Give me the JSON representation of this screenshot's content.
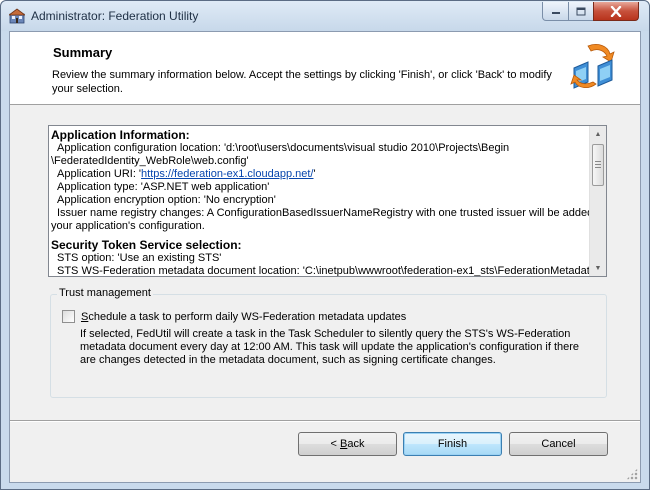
{
  "window": {
    "title": "Administrator: Federation Utility"
  },
  "header": {
    "title": "Summary",
    "description": "Review the summary information below. Accept the settings by clicking 'Finish', or click 'Back' to modify your selection."
  },
  "summary": {
    "app_info_heading": "Application Information:",
    "config_location_line1": "Application configuration location: 'd:\\root\\users\\documents\\visual studio 2010\\Projects\\Begin",
    "config_location_line2": "\\FederatedIdentity_WebRole\\web.config'",
    "app_uri_prefix": "Application URI: '",
    "app_uri_link": "https://federation-ex1.cloudapp.net/",
    "app_uri_suffix": "'",
    "app_type": "Application type: 'ASP.NET web application'",
    "encryption": "Application encryption option: 'No encryption'",
    "issuer_changes_line1": "Issuer name registry changes: A ConfigurationBasedIssuerNameRegistry with one trusted issuer will be added to",
    "issuer_changes_line2": "your application's configuration.",
    "sts_heading": "Security Token Service selection:",
    "sts_option": "STS option: 'Use an existing STS'",
    "sts_metadata": "STS WS-Federation metadata document location: 'C:\\inetpub\\wwwroot\\federation-ex1_sts\\FederationMetadata"
  },
  "trust": {
    "group_label": "Trust management",
    "checkbox_label_first": "S",
    "checkbox_label_rest": "chedule a task to perform daily WS-Federation metadata updates",
    "checkbox_checked": false,
    "description": "If selected, FedUtil will create a task in the Task Scheduler to silently query the STS's WS-Federation metadata document every day at 12:00 AM.  This task will update the application's configuration if there are changes detected in the metadata document, such as signing certificate changes."
  },
  "buttons": {
    "back_prefix": "< ",
    "back_hotkey": "B",
    "back_rest": "ack",
    "finish": "Finish",
    "cancel": "Cancel"
  }
}
